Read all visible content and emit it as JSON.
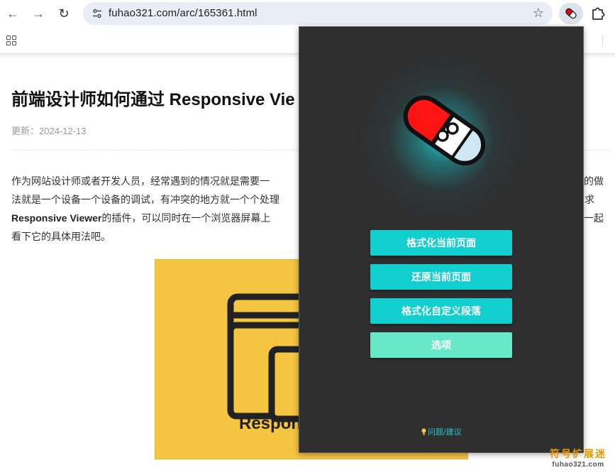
{
  "browser": {
    "url": "fuhao321.com/arc/165361.html",
    "back_icon": "←",
    "forward_icon": "→",
    "reload_icon": "↻",
    "star_icon": "☆"
  },
  "article": {
    "title": "前端设计师如何通过 Responsive Vie",
    "meta": "更新：2024-12-13",
    "lines": [
      "作为网站设计师或者开发人员，经常遇到的情况就是需要一",
      "法就是一个设备一个设备的调试，有冲突的地方就一个个处理",
      "的插件，可以同时在一个浏览器屏幕上",
      "看下它的具体用法吧。"
    ],
    "bold_term": "Responsive Viewer",
    "right_fragments": [
      "的做",
      "求",
      "一起"
    ],
    "image_text": "Respons"
  },
  "popup": {
    "buttons": [
      {
        "label": "格式化当前页面"
      },
      {
        "label": "还原当前页面"
      },
      {
        "label": "格式化自定义段落"
      },
      {
        "label": "选项"
      }
    ],
    "feedback": "问题/建议"
  },
  "watermark": {
    "cn": "符号扩展迷",
    "en": "fuhao321.com"
  },
  "colors": {
    "accent": "#12cfcf",
    "options": "#66e8c9",
    "popup_bg": "#2f2f2f",
    "hero_bg": "#f5c441"
  }
}
